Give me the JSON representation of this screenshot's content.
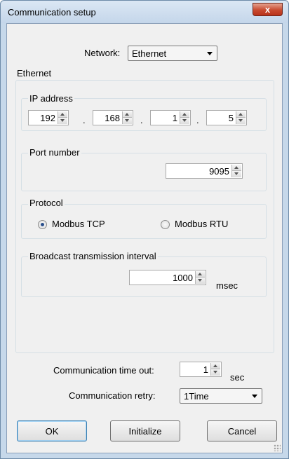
{
  "window": {
    "title": "Communication setup",
    "close_glyph": "x"
  },
  "network": {
    "label": "Network:",
    "value": "Ethernet"
  },
  "ethernet": {
    "label": "Ethernet",
    "ip_address": {
      "label": "IP address",
      "octets": [
        "192",
        "168",
        "1",
        "5"
      ],
      "separator": "."
    },
    "port": {
      "label": "Port number",
      "value": "9095"
    },
    "protocol": {
      "label": "Protocol",
      "options": [
        "Modbus TCP",
        "Modbus RTU"
      ],
      "selected": "Modbus TCP"
    },
    "broadcast": {
      "label": "Broadcast transmission interval",
      "value": "1000",
      "unit": "msec"
    }
  },
  "timeout": {
    "label": "Communication time out:",
    "value": "1",
    "unit": "sec"
  },
  "retry": {
    "label": "Communication retry:",
    "value": "1Time"
  },
  "buttons": {
    "ok": "OK",
    "initialize": "Initialize",
    "cancel": "Cancel"
  }
}
